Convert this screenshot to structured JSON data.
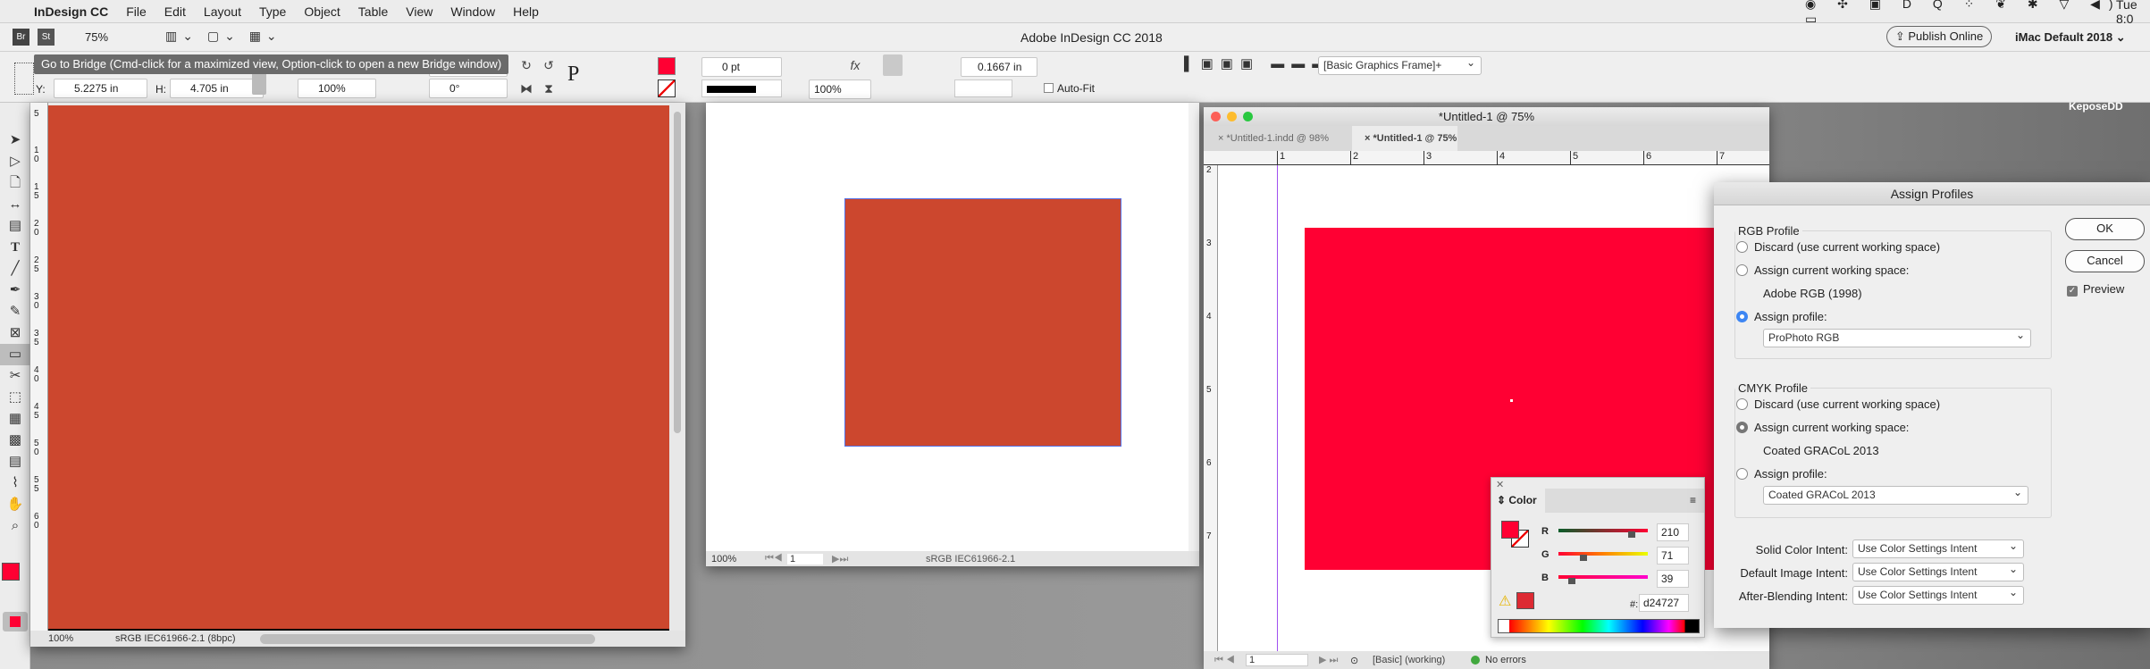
{
  "menubar": {
    "app": "InDesign CC",
    "items": [
      "File",
      "Edit",
      "Layout",
      "Type",
      "Object",
      "Table",
      "View",
      "Window",
      "Help"
    ],
    "clock": "Tue 8:0"
  },
  "appbar": {
    "br": "Br",
    "st": "St",
    "zoom": "75%",
    "title": "Adobe InDesign CC 2018",
    "publish": "Publish Online",
    "workspace": "iMac Default 2018"
  },
  "control": {
    "tooltip": "Go to Bridge (Cmd-click for a maximized view, Option-click to open a new Bridge window)",
    "y_label": "Y:",
    "y_value": "5.2275 in",
    "h_label": "H:",
    "h_value": "4.705 in",
    "scale_value": "100%",
    "angle_value": "0°",
    "stroke_weight": "0 pt",
    "opacity": "100%",
    "gap": "0.1667 in",
    "autofit": "Auto-Fit",
    "object_style": "[Basic Graphics Frame]+",
    "fill_color": "#ff0033"
  },
  "desktop_label": "KeposeDD",
  "left_window": {
    "zoom": "100%",
    "profile": "sRGB IEC61966-2.1 (8bpc)",
    "fill": "#cc472e",
    "ruler": [
      "5",
      "10",
      "15",
      "20",
      "25",
      "30",
      "35",
      "40",
      "45",
      "50",
      "55",
      "60"
    ]
  },
  "middle_window": {
    "zoom": "100%",
    "page": "1",
    "profile": "sRGB IEC61966-2.1",
    "fill": "#cc472e"
  },
  "right_window": {
    "title": "*Untitled-1 @ 75%",
    "tabs": [
      "*Untitled-1.indd @ 98%",
      "*Untitled-1 @ 75%"
    ],
    "ruler_h": [
      "1",
      "2",
      "3",
      "4",
      "5",
      "6",
      "7"
    ],
    "ruler_v": [
      "2",
      "3",
      "4",
      "5",
      "6",
      "7"
    ],
    "page": "1",
    "style": "[Basic] (working)",
    "preflight": "No errors",
    "fill": "#ff0033"
  },
  "dialog": {
    "title": "Assign Profiles",
    "rgb": {
      "legend": "RGB Profile",
      "discard": "Discard (use current working space)",
      "assign_current": "Assign current working space:",
      "current_name": "Adobe RGB (1998)",
      "assign_profile": "Assign profile:",
      "profile_value": "ProPhoto RGB",
      "selected": "assign_profile"
    },
    "cmyk": {
      "legend": "CMYK Profile",
      "discard": "Discard (use current working space)",
      "assign_current": "Assign current working space:",
      "current_name": "Coated GRACoL 2013",
      "assign_profile": "Assign profile:",
      "profile_value": "Coated GRACoL 2013",
      "selected": "assign_current"
    },
    "intents": [
      {
        "label": "Solid Color Intent:",
        "value": "Use Color Settings Intent"
      },
      {
        "label": "Default Image Intent:",
        "value": "Use Color Settings Intent"
      },
      {
        "label": "After-Blending Intent:",
        "value": "Use Color Settings Intent"
      }
    ],
    "ok": "OK",
    "cancel": "Cancel",
    "preview": "Preview",
    "preview_checked": true
  },
  "color_panel": {
    "title": "Color",
    "r_label": "R",
    "r": "210",
    "g_label": "G",
    "g": "71",
    "b_label": "B",
    "b": "39",
    "hex_label": "#:",
    "hex": "d24727",
    "r_fraction": 0.82,
    "g_fraction": 0.28,
    "b_fraction": 0.15
  }
}
